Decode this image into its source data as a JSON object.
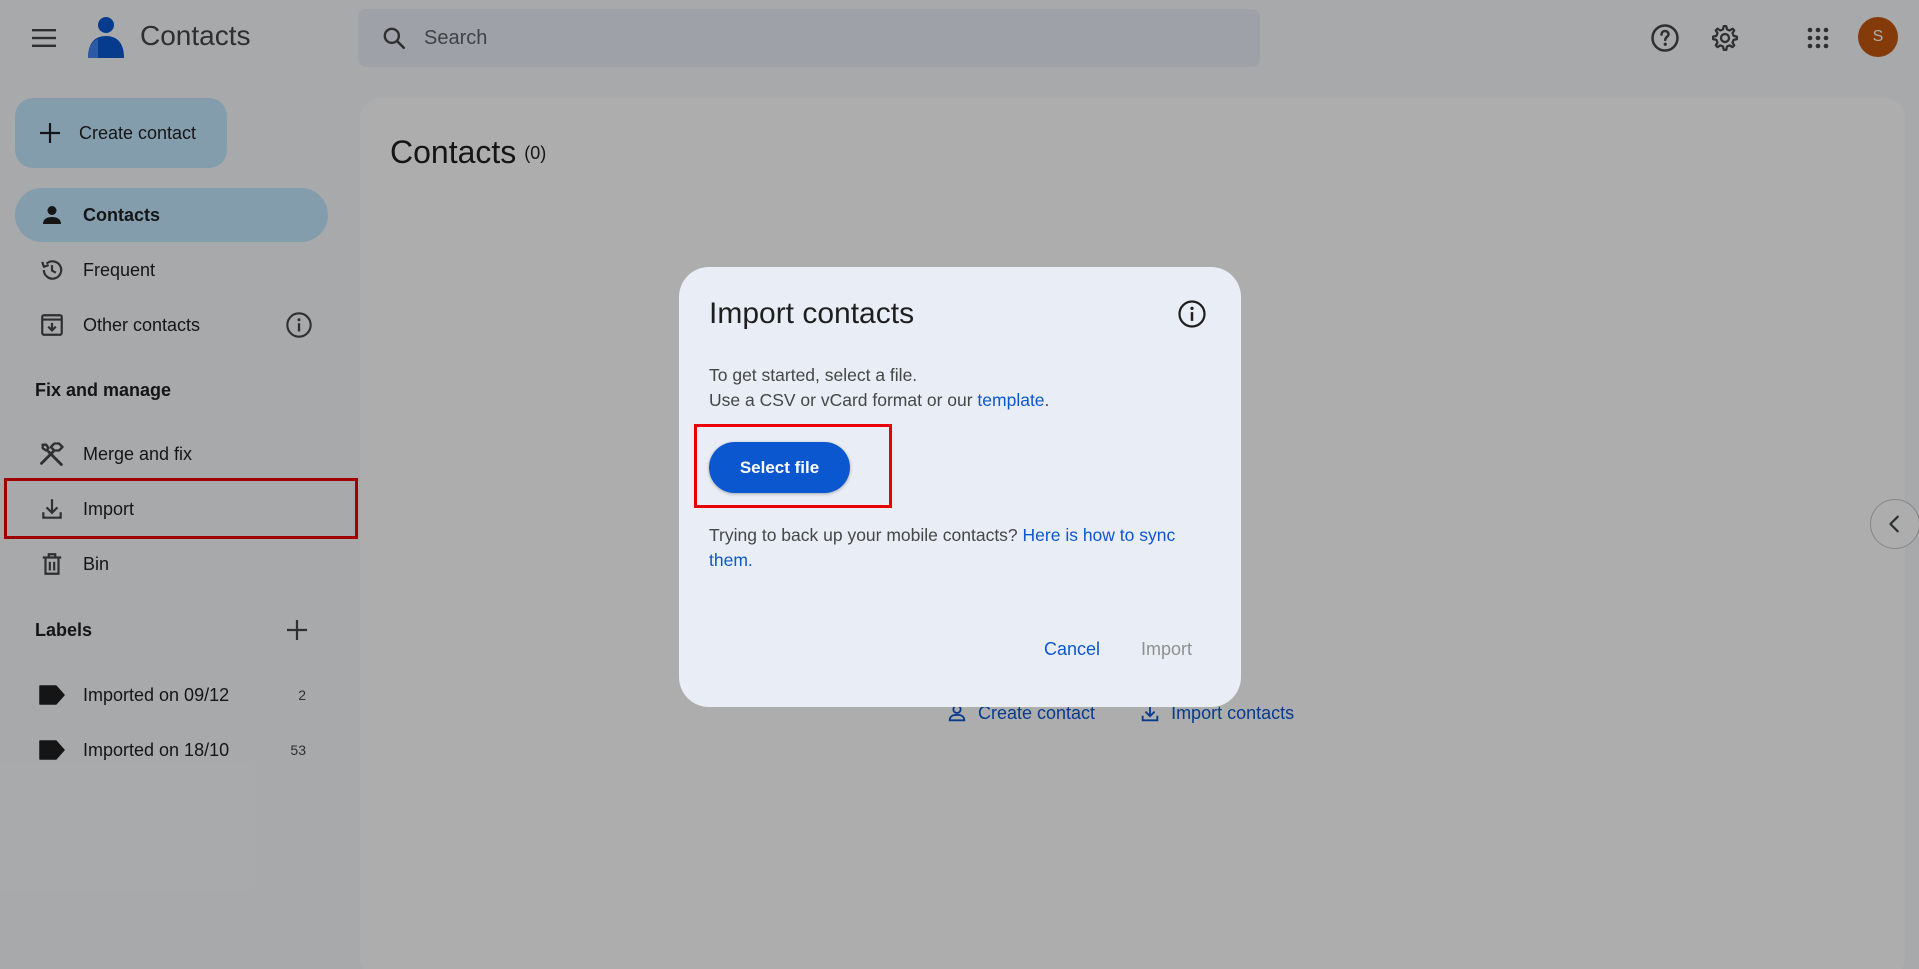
{
  "header": {
    "app_title": "Contacts",
    "search_placeholder": "Search",
    "avatar_letter": "S"
  },
  "sidebar": {
    "create_label": "Create contact",
    "items": [
      {
        "label": "Contacts",
        "icon": "person-icon",
        "active": true
      },
      {
        "label": "Frequent",
        "icon": "history-icon"
      },
      {
        "label": "Other contacts",
        "icon": "inbox-download-icon"
      }
    ],
    "fix_title": "Fix and manage",
    "fix_items": [
      {
        "label": "Merge and fix",
        "icon": "tools-icon"
      },
      {
        "label": "Import",
        "icon": "download-icon"
      },
      {
        "label": "Bin",
        "icon": "trash-icon"
      }
    ],
    "labels_title": "Labels",
    "labels": [
      {
        "label": "Imported on 09/12",
        "count": "2"
      },
      {
        "label": "Imported on 18/10",
        "count": "53"
      }
    ]
  },
  "main": {
    "title": "Contacts",
    "count": "(0)",
    "create_contact": "Create contact",
    "import_contacts": "Import contacts"
  },
  "dialog": {
    "title": "Import contacts",
    "line1": "To get started, select a file.",
    "line2_prefix": "Use a CSV or vCard format or our ",
    "line2_link": "template",
    "line2_suffix": ".",
    "select_file": "Select file",
    "sync_prefix": "Trying to back up your mobile contacts? ",
    "sync_link": "Here is how to sync them",
    "sync_suffix": ".",
    "cancel": "Cancel",
    "import": "Import"
  },
  "colors": {
    "accent": "#0b57d0",
    "active_bg": "#c2e7ff",
    "avatar": "#c5580e",
    "highlight": "#ea0000"
  }
}
